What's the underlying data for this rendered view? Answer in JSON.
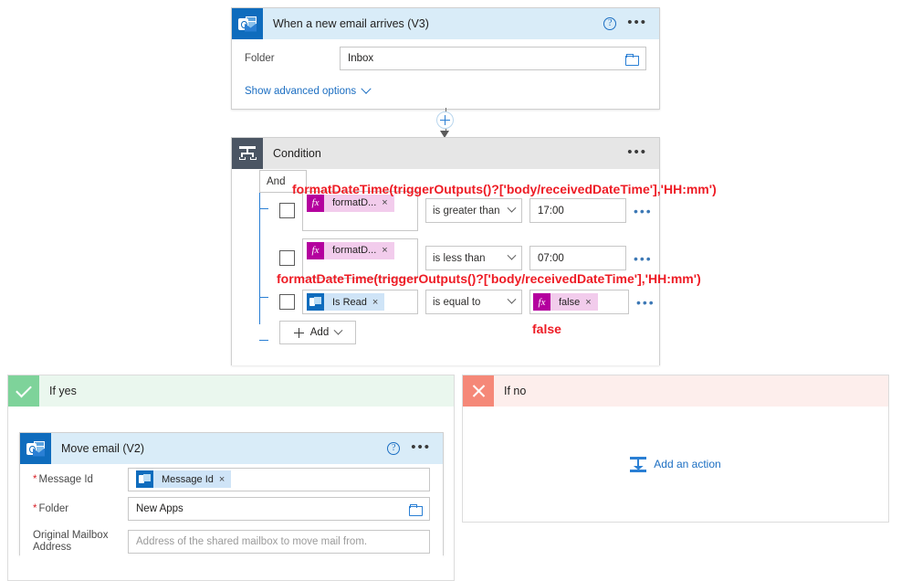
{
  "trigger": {
    "title": "When a new email arrives (V3)",
    "icon": "outlook-icon",
    "help_icon": "help-icon",
    "menu_icon": "more-options-icon",
    "fields": [
      {
        "label": "Folder",
        "value": "Inbox",
        "icon": "folder-picker-icon"
      }
    ],
    "advanced_link": "Show advanced options"
  },
  "connector": {
    "add_icon": "plus-icon",
    "arrow_icon": "arrow-down-icon"
  },
  "condition": {
    "title": "Condition",
    "icon": "condition-icon",
    "menu_icon": "more-options-icon",
    "operator": "And",
    "rows": [
      {
        "checkbox": "row-checkbox",
        "token": {
          "type": "fx",
          "label": "formatD...",
          "remove": "×"
        },
        "operator": "is greater than",
        "value": "17:00",
        "menu": "row-more-options-icon"
      },
      {
        "checkbox": "row-checkbox",
        "token": {
          "type": "fx",
          "label": "formatD...",
          "remove": "×"
        },
        "operator": "is less than",
        "value": "07:00",
        "menu": "row-more-options-icon"
      },
      {
        "checkbox": "row-checkbox",
        "token": {
          "type": "outlook",
          "label": "Is Read",
          "remove": "×"
        },
        "operator": "is equal to",
        "value_token": {
          "type": "fx",
          "label": "false",
          "remove": "×"
        },
        "menu": "row-more-options-icon"
      }
    ],
    "add_button": "Add"
  },
  "annotations": [
    {
      "text": "formatDateTime(triggerOutputs()?['body/receivedDateTime'],'HH:mm')",
      "color": "#ee1c25"
    },
    {
      "text": "formatDateTime(triggerOutputs()?['body/receivedDateTime'],'HH:mm')",
      "color": "#ee1c25"
    },
    {
      "text": "false",
      "color": "#ee1c25"
    }
  ],
  "branch_yes": {
    "title": "If yes",
    "icon": "check-icon",
    "action": {
      "title": "Move email (V2)",
      "icon": "outlook-icon",
      "help_icon": "help-icon",
      "menu_icon": "more-options-icon",
      "fields": [
        {
          "label": "Message Id",
          "required": true,
          "token": {
            "type": "outlook",
            "label": "Message Id",
            "remove": "×"
          }
        },
        {
          "label": "Folder",
          "required": true,
          "value": "New Apps",
          "icon": "folder-picker-icon"
        },
        {
          "label": "Original Mailbox Address",
          "required": false,
          "placeholder": "Address of the shared mailbox to move mail from."
        }
      ]
    }
  },
  "branch_no": {
    "title": "If no",
    "icon": "close-icon",
    "add_action": "Add an action",
    "add_action_icon": "add-action-icon"
  }
}
